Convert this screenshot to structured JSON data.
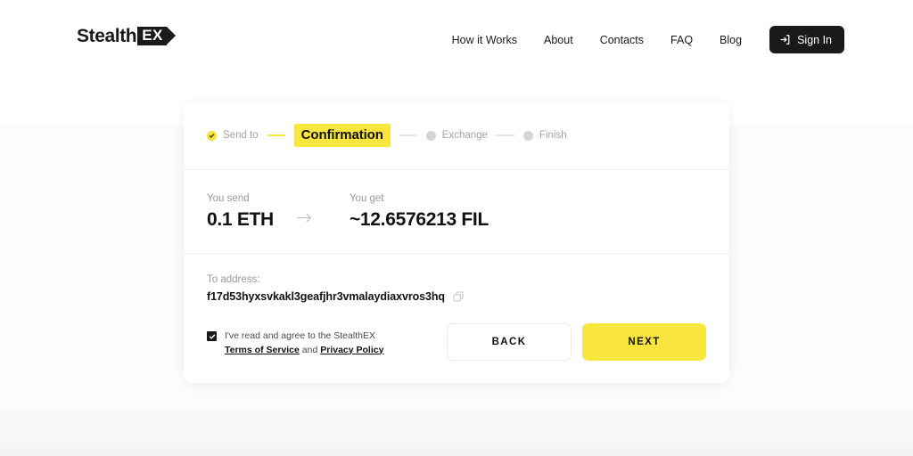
{
  "brand": {
    "word": "Stealth",
    "badge": "EX"
  },
  "nav": {
    "links": [
      {
        "label": "How it Works"
      },
      {
        "label": "About"
      },
      {
        "label": "Contacts"
      },
      {
        "label": "FAQ"
      },
      {
        "label": "Blog"
      }
    ],
    "signin_label": "Sign In",
    "signin_icon": "login-icon"
  },
  "stepper": {
    "steps": [
      {
        "label": "Send to",
        "state": "done"
      },
      {
        "label": "Confirmation",
        "state": "active"
      },
      {
        "label": "Exchange",
        "state": "pending"
      },
      {
        "label": "Finish",
        "state": "pending"
      }
    ]
  },
  "amounts": {
    "send_label": "You send",
    "send_value": "0.1 ETH",
    "arrow_icon": "arrow-right-icon",
    "get_label": "You get",
    "get_value": "~12.6576213 FIL"
  },
  "address": {
    "label": "To address:",
    "value": "f17d53hyxsvkakl3geafjhr3vmalaydiaxvros3hq",
    "copy_icon": "copy-icon"
  },
  "agreement": {
    "intro": "I've read and agree to the StealthEX",
    "terms_link": "Terms of Service",
    "conjunction": "and",
    "privacy_link": "Privacy Policy"
  },
  "buttons": {
    "back_label": "BACK",
    "next_label": "NEXT"
  },
  "colors": {
    "accent_yellow": "#F8E53E",
    "dark": "#1A1A1A",
    "muted_text": "#9A9A9A",
    "page_bg": "#FCFCFC"
  }
}
